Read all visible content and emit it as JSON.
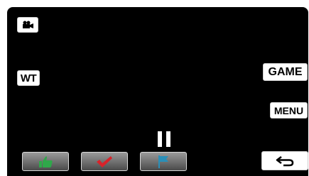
{
  "buttons": {
    "wt_label": "WT",
    "game_label": "GAME",
    "menu_label": "MENU"
  },
  "icons": {
    "mode": "video-camera-icon",
    "pause": "pause-icon",
    "rating": "thumbs-up-icon",
    "check": "checkmark-icon",
    "flag": "flag-icon",
    "back": "return-arrow-icon"
  },
  "colors": {
    "screen_background": "#000000",
    "thumbs_up": "#2fa84a",
    "checkmark": "#d8232a",
    "flag": "#2a8fb8"
  }
}
